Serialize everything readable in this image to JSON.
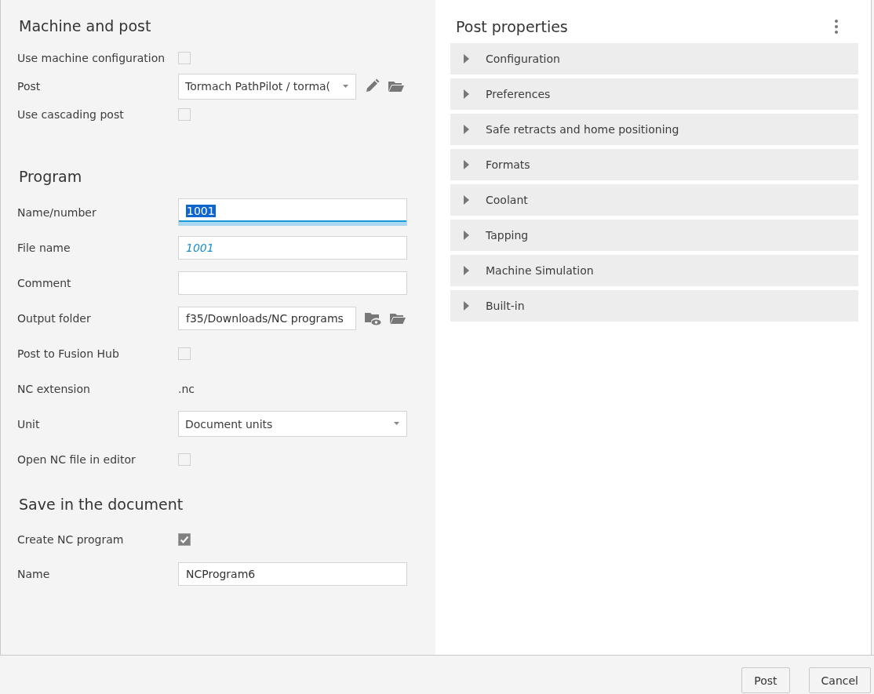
{
  "left_sections": [
    {
      "title": "Machine and post",
      "rows": [
        {
          "label": "Use machine configuration",
          "kind": "checkbox",
          "checked": false
        },
        {
          "label": "Post",
          "kind": "post-select",
          "value": "Tormach PathPilot / torma("
        },
        {
          "label": "Use cascading post",
          "kind": "checkbox",
          "checked": false
        }
      ]
    },
    {
      "title": "Program",
      "rows": [
        {
          "label": "Name/number",
          "kind": "field",
          "value": "1001",
          "focused": true
        },
        {
          "label": "File name",
          "kind": "field",
          "placeholder": "1001",
          "focused": false
        },
        {
          "label": "Comment",
          "kind": "field",
          "focused": false
        },
        {
          "label": "Output folder",
          "kind": "folder-field",
          "value": "f35/Downloads/NC programs"
        },
        {
          "label": "Post to Fusion Hub",
          "kind": "checkbox",
          "checked": false
        },
        {
          "label": "NC extension",
          "kind": "text",
          "value": ".nc"
        },
        {
          "label": "Unit",
          "kind": "select",
          "value": "Document units"
        },
        {
          "label": "Open NC file in editor",
          "kind": "checkbox",
          "checked": false
        }
      ]
    },
    {
      "title": "Save in the document",
      "rows": [
        {
          "label": "Create NC program",
          "kind": "checkbox",
          "checked": true
        },
        {
          "label": "Name",
          "kind": "field",
          "value": "NCProgram6",
          "focused": false
        }
      ]
    }
  ],
  "post_properties": {
    "title": "Post properties",
    "groups": [
      {
        "label": "Configuration",
        "expanded": false
      },
      {
        "label": "Preferences",
        "expanded": false
      },
      {
        "label": "Safe retracts and home positioning",
        "expanded": false
      },
      {
        "label": "Formats",
        "expanded": false
      },
      {
        "label": "Coolant",
        "expanded": false
      },
      {
        "label": "Tapping",
        "expanded": false
      },
      {
        "label": "Machine Simulation",
        "expanded": false
      },
      {
        "label": "Built-in",
        "expanded": false
      }
    ]
  },
  "buttons": [
    "Post",
    "Cancel"
  ]
}
